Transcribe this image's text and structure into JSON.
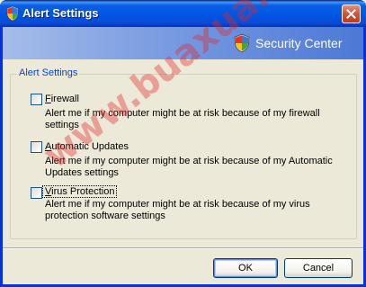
{
  "window": {
    "title": "Alert Settings"
  },
  "banner": {
    "brand": "Security Center"
  },
  "group": {
    "legend": "Alert Settings",
    "options": [
      {
        "label_accel": "F",
        "label_rest": "irewall",
        "checked": false,
        "description": "Alert me if my computer might be at risk because of my firewall settings"
      },
      {
        "label_accel": "A",
        "label_rest": "utomatic Updates",
        "checked": false,
        "description": "Alert me if my computer might be at risk because of my Automatic Updates settings"
      },
      {
        "label_accel": "V",
        "label_rest": "irus Protection",
        "checked": false,
        "description": "Alert me if my computer might be at risk because of my virus protection software settings"
      }
    ]
  },
  "buttons": {
    "ok": "OK",
    "cancel": "Cancel"
  },
  "watermark": "www.buaxua.vn",
  "colors": {
    "title_bar": "#0055E5",
    "close_button": "#D8553A",
    "banner": "#7D9EE2",
    "legend_text": "#0046D5",
    "face": "#ECE9D8"
  }
}
